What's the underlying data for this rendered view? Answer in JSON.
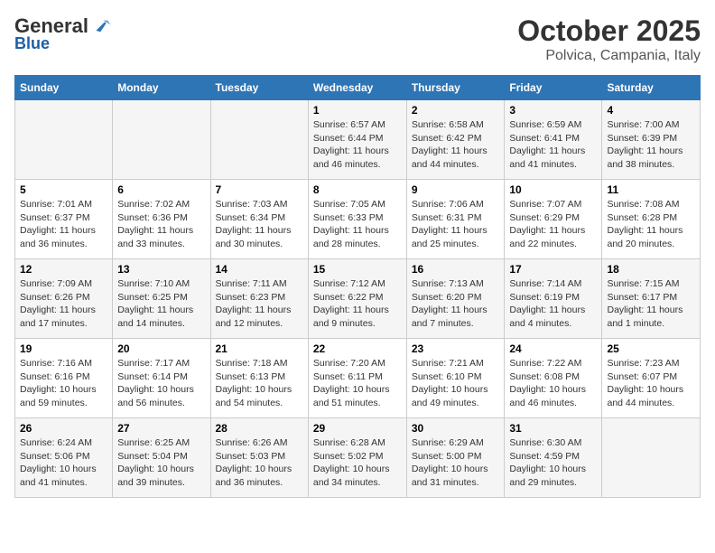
{
  "header": {
    "logo_general": "General",
    "logo_blue": "Blue",
    "month": "October 2025",
    "location": "Polvica, Campania, Italy"
  },
  "days_of_week": [
    "Sunday",
    "Monday",
    "Tuesday",
    "Wednesday",
    "Thursday",
    "Friday",
    "Saturday"
  ],
  "weeks": [
    [
      {
        "day": "",
        "info": ""
      },
      {
        "day": "",
        "info": ""
      },
      {
        "day": "",
        "info": ""
      },
      {
        "day": "1",
        "info": "Sunrise: 6:57 AM\nSunset: 6:44 PM\nDaylight: 11 hours and 46 minutes."
      },
      {
        "day": "2",
        "info": "Sunrise: 6:58 AM\nSunset: 6:42 PM\nDaylight: 11 hours and 44 minutes."
      },
      {
        "day": "3",
        "info": "Sunrise: 6:59 AM\nSunset: 6:41 PM\nDaylight: 11 hours and 41 minutes."
      },
      {
        "day": "4",
        "info": "Sunrise: 7:00 AM\nSunset: 6:39 PM\nDaylight: 11 hours and 38 minutes."
      }
    ],
    [
      {
        "day": "5",
        "info": "Sunrise: 7:01 AM\nSunset: 6:37 PM\nDaylight: 11 hours and 36 minutes."
      },
      {
        "day": "6",
        "info": "Sunrise: 7:02 AM\nSunset: 6:36 PM\nDaylight: 11 hours and 33 minutes."
      },
      {
        "day": "7",
        "info": "Sunrise: 7:03 AM\nSunset: 6:34 PM\nDaylight: 11 hours and 30 minutes."
      },
      {
        "day": "8",
        "info": "Sunrise: 7:05 AM\nSunset: 6:33 PM\nDaylight: 11 hours and 28 minutes."
      },
      {
        "day": "9",
        "info": "Sunrise: 7:06 AM\nSunset: 6:31 PM\nDaylight: 11 hours and 25 minutes."
      },
      {
        "day": "10",
        "info": "Sunrise: 7:07 AM\nSunset: 6:29 PM\nDaylight: 11 hours and 22 minutes."
      },
      {
        "day": "11",
        "info": "Sunrise: 7:08 AM\nSunset: 6:28 PM\nDaylight: 11 hours and 20 minutes."
      }
    ],
    [
      {
        "day": "12",
        "info": "Sunrise: 7:09 AM\nSunset: 6:26 PM\nDaylight: 11 hours and 17 minutes."
      },
      {
        "day": "13",
        "info": "Sunrise: 7:10 AM\nSunset: 6:25 PM\nDaylight: 11 hours and 14 minutes."
      },
      {
        "day": "14",
        "info": "Sunrise: 7:11 AM\nSunset: 6:23 PM\nDaylight: 11 hours and 12 minutes."
      },
      {
        "day": "15",
        "info": "Sunrise: 7:12 AM\nSunset: 6:22 PM\nDaylight: 11 hours and 9 minutes."
      },
      {
        "day": "16",
        "info": "Sunrise: 7:13 AM\nSunset: 6:20 PM\nDaylight: 11 hours and 7 minutes."
      },
      {
        "day": "17",
        "info": "Sunrise: 7:14 AM\nSunset: 6:19 PM\nDaylight: 11 hours and 4 minutes."
      },
      {
        "day": "18",
        "info": "Sunrise: 7:15 AM\nSunset: 6:17 PM\nDaylight: 11 hours and 1 minute."
      }
    ],
    [
      {
        "day": "19",
        "info": "Sunrise: 7:16 AM\nSunset: 6:16 PM\nDaylight: 10 hours and 59 minutes."
      },
      {
        "day": "20",
        "info": "Sunrise: 7:17 AM\nSunset: 6:14 PM\nDaylight: 10 hours and 56 minutes."
      },
      {
        "day": "21",
        "info": "Sunrise: 7:18 AM\nSunset: 6:13 PM\nDaylight: 10 hours and 54 minutes."
      },
      {
        "day": "22",
        "info": "Sunrise: 7:20 AM\nSunset: 6:11 PM\nDaylight: 10 hours and 51 minutes."
      },
      {
        "day": "23",
        "info": "Sunrise: 7:21 AM\nSunset: 6:10 PM\nDaylight: 10 hours and 49 minutes."
      },
      {
        "day": "24",
        "info": "Sunrise: 7:22 AM\nSunset: 6:08 PM\nDaylight: 10 hours and 46 minutes."
      },
      {
        "day": "25",
        "info": "Sunrise: 7:23 AM\nSunset: 6:07 PM\nDaylight: 10 hours and 44 minutes."
      }
    ],
    [
      {
        "day": "26",
        "info": "Sunrise: 6:24 AM\nSunset: 5:06 PM\nDaylight: 10 hours and 41 minutes."
      },
      {
        "day": "27",
        "info": "Sunrise: 6:25 AM\nSunset: 5:04 PM\nDaylight: 10 hours and 39 minutes."
      },
      {
        "day": "28",
        "info": "Sunrise: 6:26 AM\nSunset: 5:03 PM\nDaylight: 10 hours and 36 minutes."
      },
      {
        "day": "29",
        "info": "Sunrise: 6:28 AM\nSunset: 5:02 PM\nDaylight: 10 hours and 34 minutes."
      },
      {
        "day": "30",
        "info": "Sunrise: 6:29 AM\nSunset: 5:00 PM\nDaylight: 10 hours and 31 minutes."
      },
      {
        "day": "31",
        "info": "Sunrise: 6:30 AM\nSunset: 4:59 PM\nDaylight: 10 hours and 29 minutes."
      },
      {
        "day": "",
        "info": ""
      }
    ]
  ]
}
